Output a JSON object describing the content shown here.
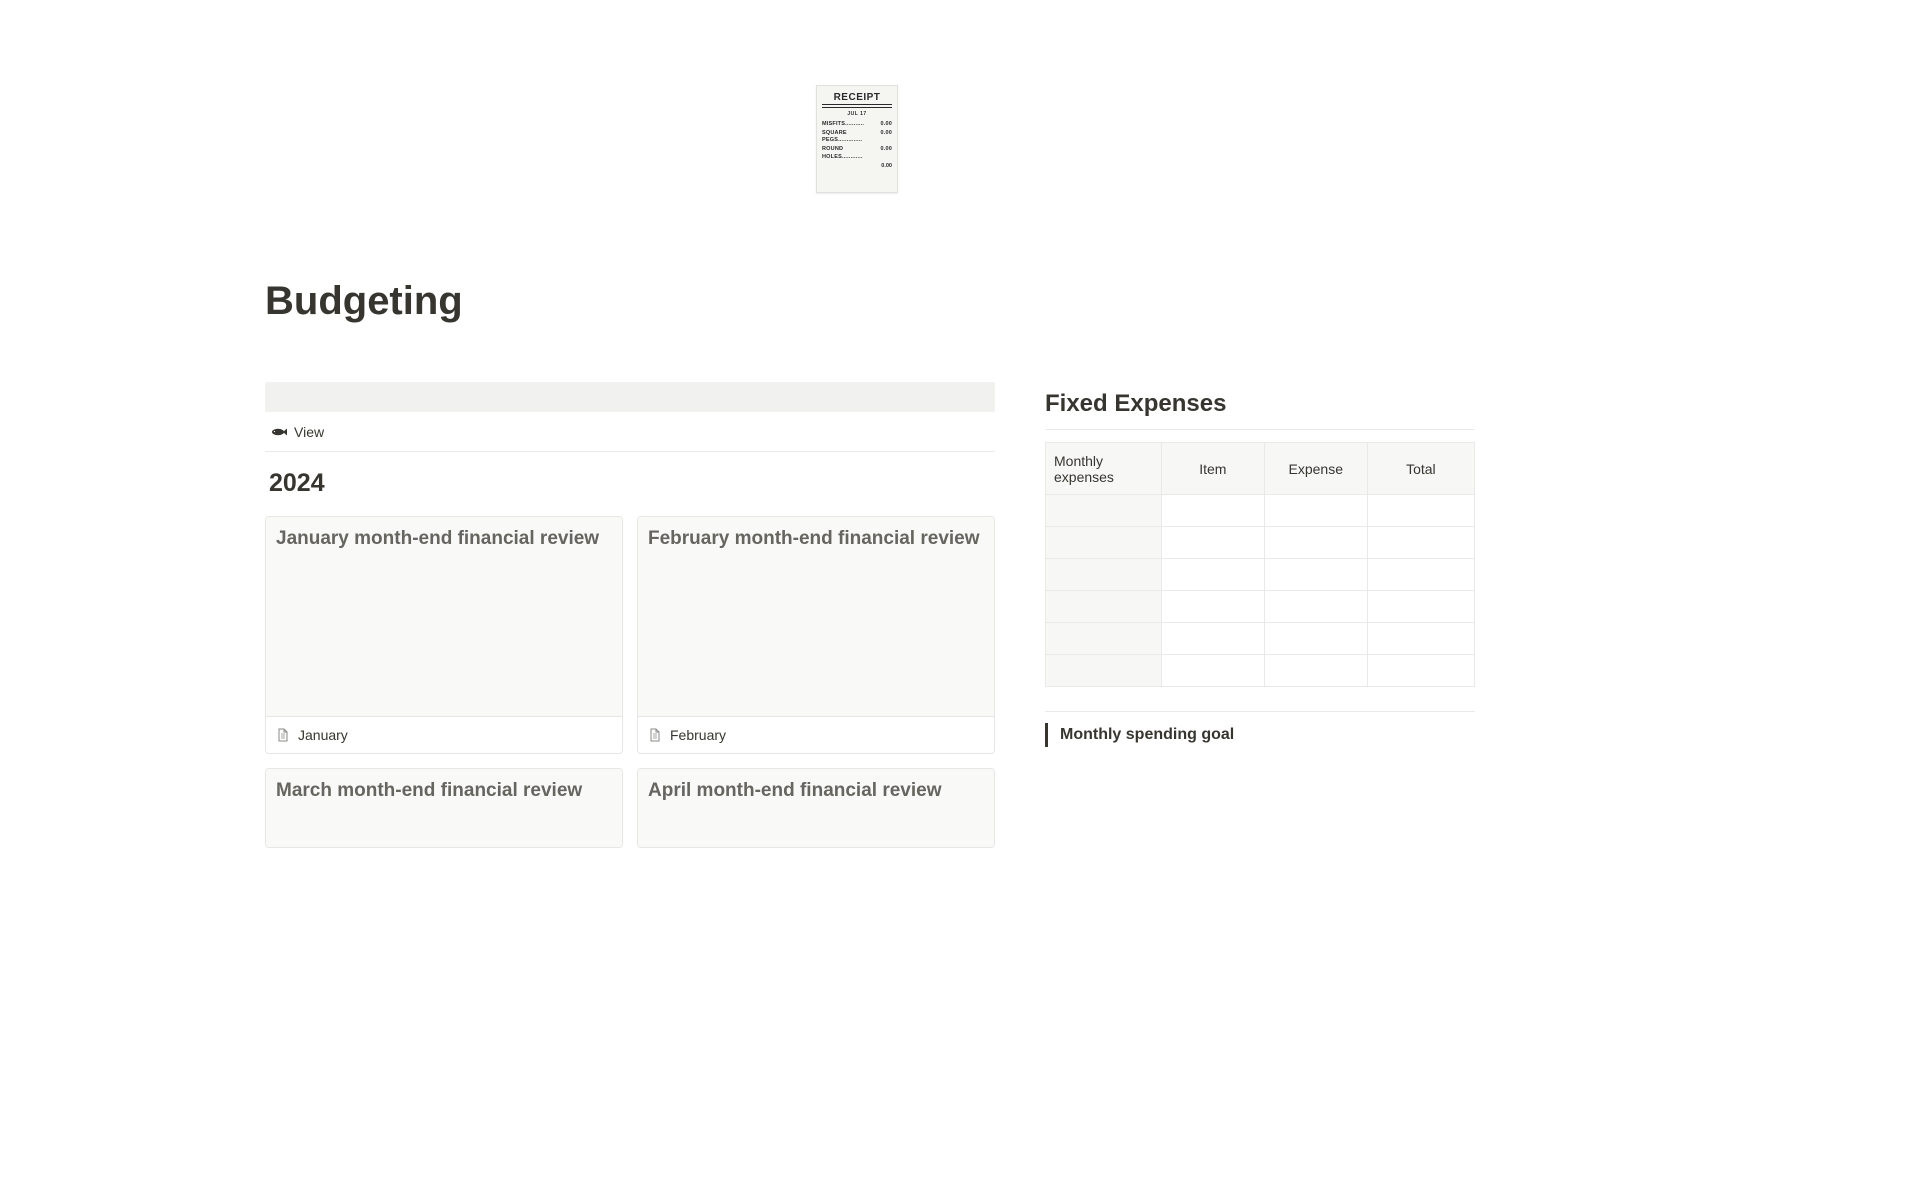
{
  "receipt": {
    "title": "RECEIPT",
    "date": "JUL 17",
    "lines": [
      {
        "label": "MISFITS...........",
        "amount": "0.00"
      },
      {
        "label": "SQUARE\nPEGS..............",
        "amount": "0.00"
      },
      {
        "label": "ROUND\nHOLES............",
        "amount": "0.00"
      }
    ],
    "total": "0.00"
  },
  "page_title": "Budgeting",
  "view": {
    "label": "View"
  },
  "year": "2024",
  "cards": [
    {
      "title": "January month-end financial review",
      "footer": "January"
    },
    {
      "title": "February month-end financial review",
      "footer": "February"
    },
    {
      "title": "March month-end financial review",
      "footer": ""
    },
    {
      "title": "April month-end financial review",
      "footer": ""
    }
  ],
  "fixed_expenses": {
    "title": "Fixed Expenses",
    "headers": [
      "Monthly expenses",
      "Item",
      "Expense",
      "Total"
    ],
    "rows": 6
  },
  "spending_goal": {
    "label": "Monthly spending goal"
  }
}
